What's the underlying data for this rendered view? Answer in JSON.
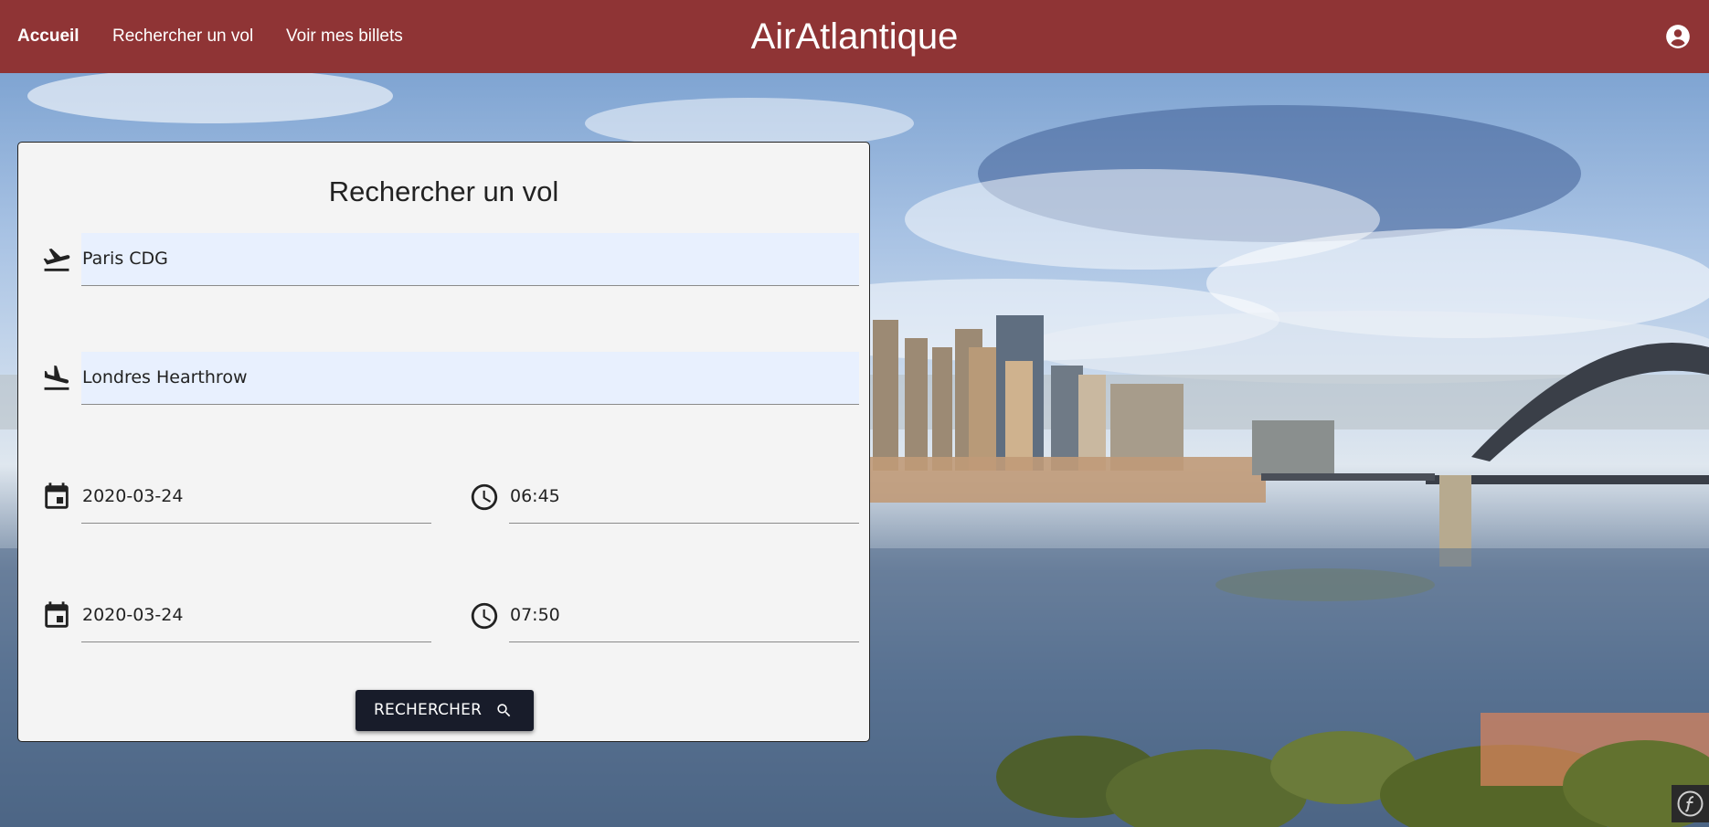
{
  "navbar": {
    "links": [
      {
        "label": "Accueil"
      },
      {
        "label": "Rechercher un vol"
      },
      {
        "label": "Voir mes billets"
      }
    ],
    "brand": "AirAtlantique",
    "account_icon": "account-circle-icon"
  },
  "search": {
    "title": "Rechercher un vol",
    "departure": {
      "value": "Paris CDG",
      "icon": "flight-takeoff-icon"
    },
    "arrival": {
      "value": "Londres Hearthrow",
      "icon": "flight-land-icon"
    },
    "departure_date": {
      "value": "2020-03-24",
      "icon": "calendar-icon"
    },
    "departure_time": {
      "value": "06:45",
      "icon": "clock-icon"
    },
    "return_date": {
      "value": "2020-03-24",
      "icon": "calendar-icon"
    },
    "return_time": {
      "value": "07:50",
      "icon": "clock-icon"
    },
    "button_label": "RECHERCHER",
    "button_icon": "search-icon"
  },
  "colors": {
    "navbar": "#8f3435",
    "card": "#f4f4f4",
    "autofill": "#e8f0fe",
    "button": "#181c2a"
  },
  "debug_toolbar": {
    "icon": "symfony-icon"
  }
}
